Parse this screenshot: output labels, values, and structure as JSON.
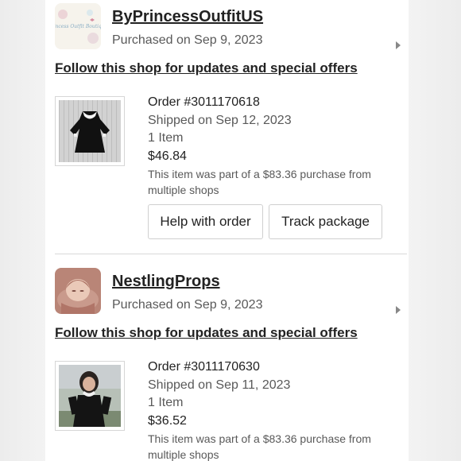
{
  "shops": [
    {
      "name": "ByPrincessOutfitUS",
      "purchased": "Purchased on Sep 9, 2023",
      "follow_text": "Follow this shop for updates and special offers",
      "avatar_text": "Princess Outfit Boutique",
      "order": {
        "number": "Order #3011170618",
        "shipped": "Shipped on Sep 12, 2023",
        "items": "1 Item",
        "price": "$46.84",
        "note": "This item was part of a $83.36 purchase from multiple shops"
      },
      "actions": {
        "help_label": "Help with order",
        "track_label": "Track package"
      }
    },
    {
      "name": "NestlingProps",
      "purchased": "Purchased on Sep 9, 2023",
      "follow_text": "Follow this shop for updates and special offers",
      "order": {
        "number": "Order #3011170630",
        "shipped": "Shipped on Sep 11, 2023",
        "items": "1 Item",
        "price": "$36.52",
        "note": "This item was part of a $83.36 purchase from multiple shops"
      }
    }
  ],
  "icons": {
    "row_chevron": "chevron-right-icon"
  }
}
